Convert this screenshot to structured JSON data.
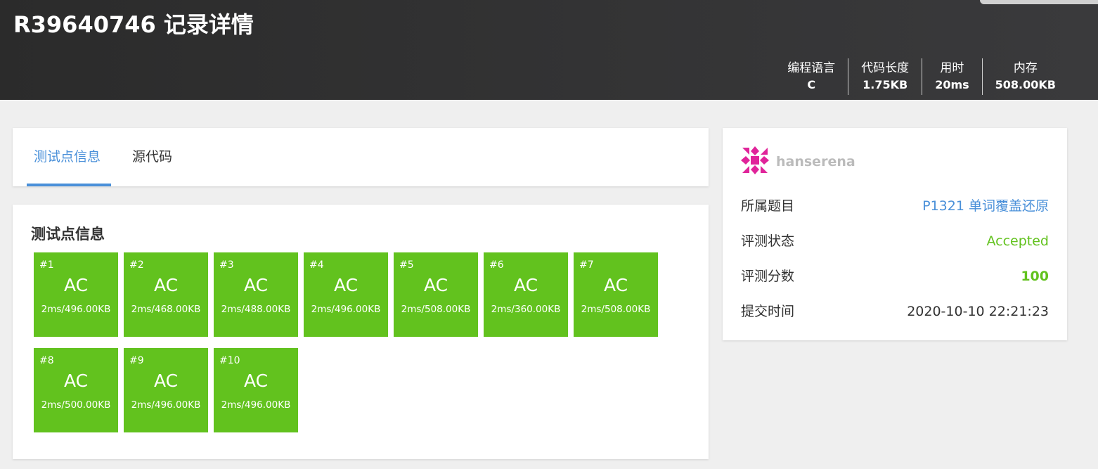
{
  "header": {
    "title": "R39640746 记录详情",
    "stats": [
      {
        "label": "编程语言",
        "value": "C"
      },
      {
        "label": "代码长度",
        "value": "1.75KB"
      },
      {
        "label": "用时",
        "value": "20ms"
      },
      {
        "label": "内存",
        "value": "508.00KB"
      }
    ]
  },
  "tabs": [
    {
      "label": "测试点信息",
      "active": true
    },
    {
      "label": "源代码",
      "active": false
    }
  ],
  "tests": {
    "title": "测试点信息",
    "cases": [
      {
        "num": "#1",
        "status": "AC",
        "result": "2ms/496.00KB"
      },
      {
        "num": "#2",
        "status": "AC",
        "result": "2ms/468.00KB"
      },
      {
        "num": "#3",
        "status": "AC",
        "result": "2ms/488.00KB"
      },
      {
        "num": "#4",
        "status": "AC",
        "result": "2ms/496.00KB"
      },
      {
        "num": "#5",
        "status": "AC",
        "result": "2ms/508.00KB"
      },
      {
        "num": "#6",
        "status": "AC",
        "result": "2ms/360.00KB"
      },
      {
        "num": "#7",
        "status": "AC",
        "result": "2ms/508.00KB"
      },
      {
        "num": "#8",
        "status": "AC",
        "result": "2ms/500.00KB"
      },
      {
        "num": "#9",
        "status": "AC",
        "result": "2ms/496.00KB"
      },
      {
        "num": "#10",
        "status": "AC",
        "result": "2ms/496.00KB"
      }
    ]
  },
  "info": {
    "username": "hanserena",
    "rows": [
      {
        "key": "所属题目",
        "value": "P1321 单词覆盖还原"
      },
      {
        "key": "评测状态",
        "value": "Accepted"
      },
      {
        "key": "评测分数",
        "value": "100"
      },
      {
        "key": "提交时间",
        "value": "2020-10-10 22:21:23"
      }
    ]
  },
  "colors": {
    "accent": "#4a90d9",
    "accepted": "#62c21e",
    "avatar": "#e0249a"
  }
}
